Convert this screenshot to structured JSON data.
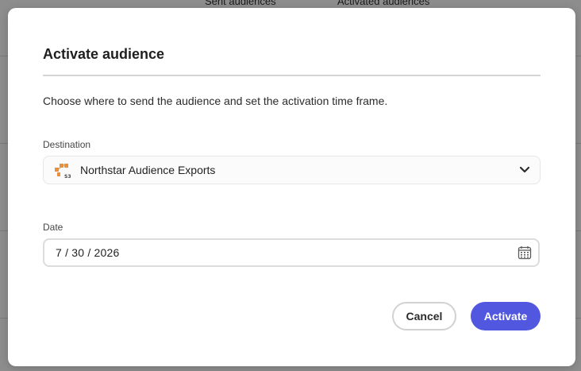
{
  "background": {
    "column_headers": [
      "Sent audiences",
      "Activated audiences"
    ]
  },
  "dialog": {
    "title": "Activate audience",
    "description": "Choose where to send the audience and set the activation time frame.",
    "destination": {
      "label": "Destination",
      "value": "Northstar Audience Exports",
      "icon": "s3-bucket-icon",
      "icon_text": "S3"
    },
    "date": {
      "label": "Date",
      "value": "7 / 30 / 2026"
    },
    "buttons": {
      "cancel": "Cancel",
      "activate": "Activate"
    }
  },
  "colors": {
    "primary_button": "#5257e0",
    "s3_icon": "#e8913a"
  }
}
